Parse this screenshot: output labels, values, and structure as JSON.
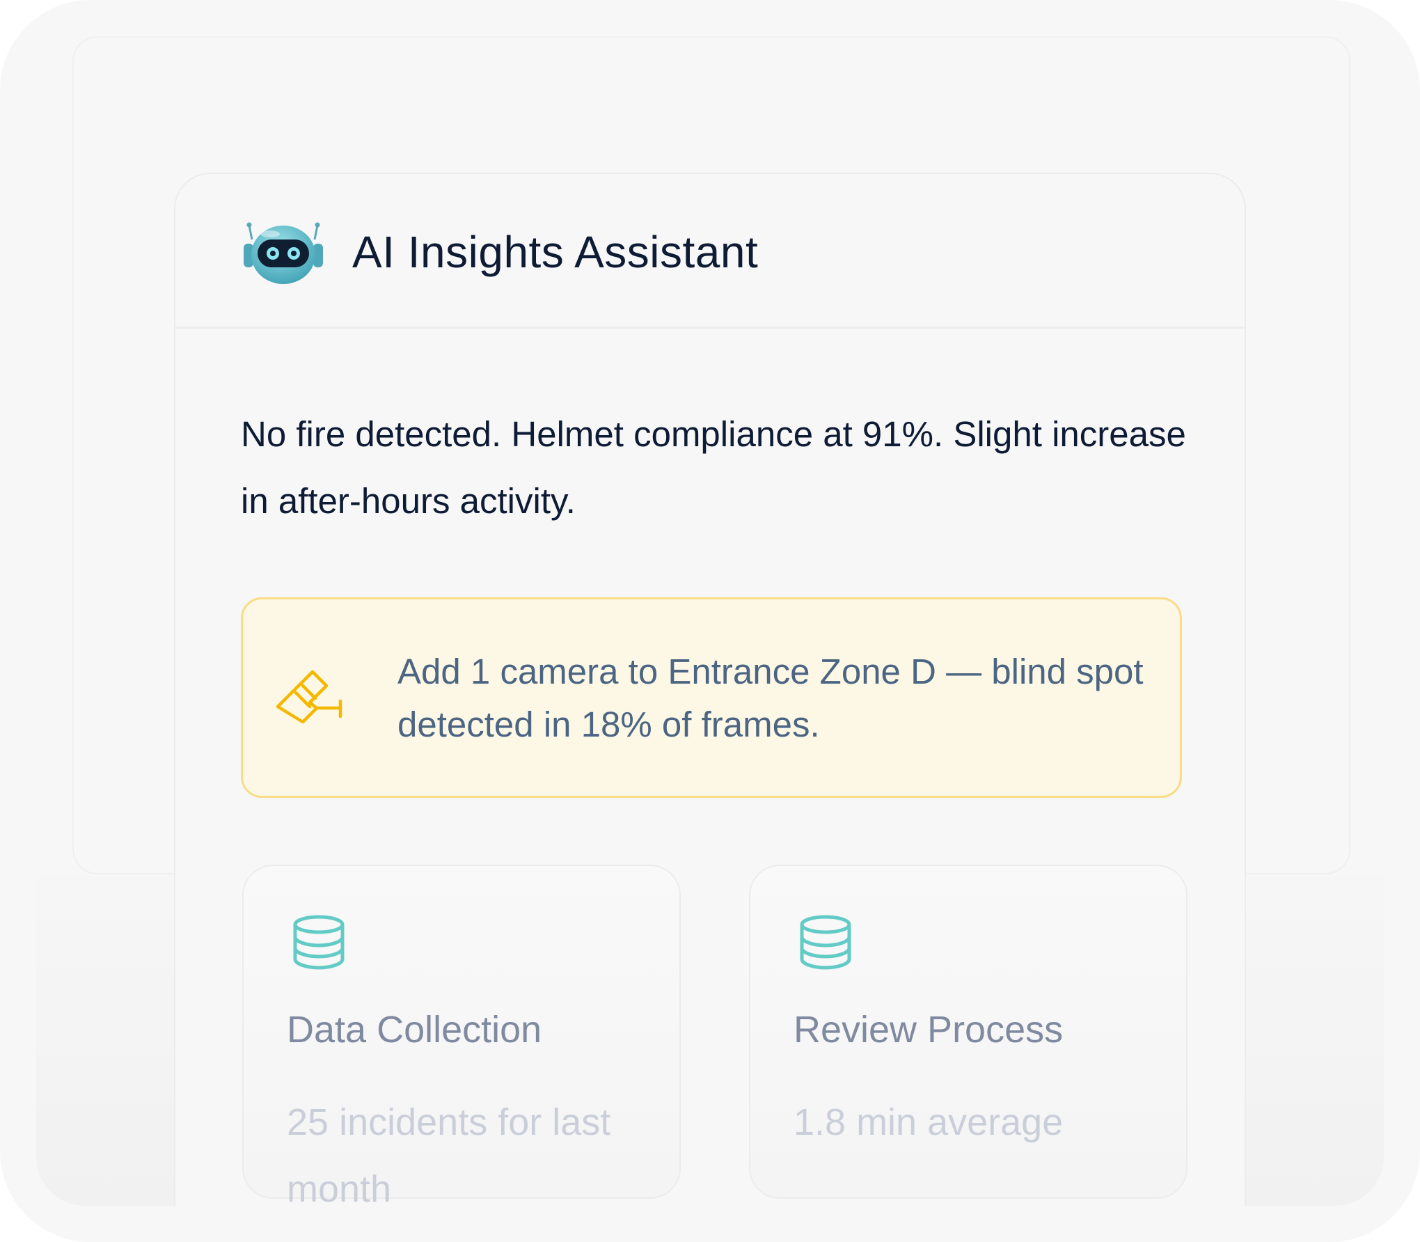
{
  "assistant": {
    "title": "AI Insights Assistant",
    "avatar_icon": "robot-icon",
    "summary": "No fire detected. Helmet compliance at 91%. Slight increase in after-hours activity."
  },
  "alert": {
    "icon": "security-camera-icon",
    "text": "Add 1 camera to Entrance Zone D — blind spot detected in 18% of frames.",
    "accent_color": "#f5b800",
    "background": "#fdf8e6",
    "border": "#f8dd86"
  },
  "stats": [
    {
      "icon": "database-icon",
      "title": "Data Collection",
      "description": "25 incidents for last month"
    },
    {
      "icon": "database-icon",
      "title": "Review Process",
      "description": "1.8 min average"
    }
  ],
  "colors": {
    "icon_teal": "#62cbc6",
    "text_dark": "#0d1b34"
  }
}
